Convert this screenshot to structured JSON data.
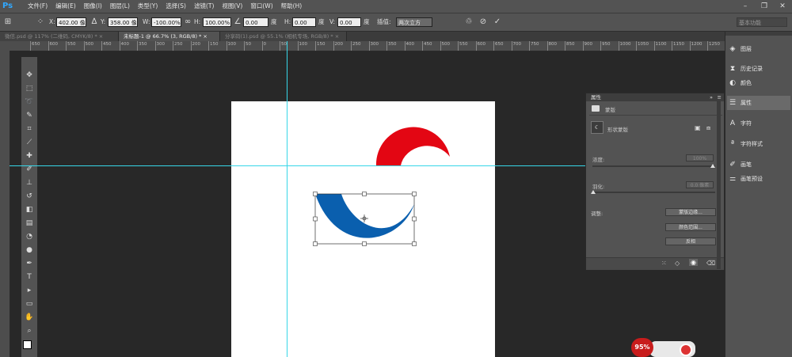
{
  "app": {
    "logo": "Ps"
  },
  "menu": [
    "文件(F)",
    "编辑(E)",
    "图像(I)",
    "图层(L)",
    "类型(Y)",
    "选择(S)",
    "滤镜(T)",
    "视图(V)",
    "窗口(W)",
    "帮助(H)"
  ],
  "window_controls": [
    "–",
    "❐",
    "✕"
  ],
  "options": {
    "x_label": "X:",
    "x_value": "402.00 像",
    "y_label": "Y:",
    "y_value": "358.00 像",
    "w_label": "W:",
    "w_value": "-100.00%",
    "h_label": "H:",
    "h_value": "100.00%",
    "angle_value": "0.00",
    "angle_unit": "度",
    "hskew_label": "H:",
    "hskew_value": "0.00",
    "hskew_unit": "度",
    "vskew_label": "V:",
    "vskew_value": "0.00",
    "vskew_unit": "度",
    "interp_label": "插值:",
    "interp_value": "两次立方",
    "workspace": "基本功能"
  },
  "tabs": [
    {
      "label": "微信.psd @ 117% (二维码, CMYK/8) *",
      "close": "×"
    },
    {
      "label": "未标题-1 @ 66.7% (3, RGB/8) *",
      "close": "×"
    },
    {
      "label": "分享码(1).psd @ 55.1% (相机专场, RGB/8) *",
      "close": "×"
    }
  ],
  "ruler_h": [
    "650",
    "600",
    "550",
    "500",
    "450",
    "400",
    "350",
    "300",
    "250",
    "200",
    "150",
    "100",
    "50",
    "0",
    "50",
    "100",
    "150",
    "200",
    "250",
    "300",
    "350",
    "400",
    "450",
    "500",
    "550",
    "600",
    "650",
    "700",
    "750",
    "800",
    "850",
    "900",
    "950",
    "1000",
    "1050",
    "1100",
    "1150",
    "1200",
    "1250"
  ],
  "dock": [
    {
      "label": "图层",
      "icon": "layers-icon"
    },
    {
      "label": "历史记录",
      "icon": "history-icon"
    },
    {
      "label": "颜色",
      "icon": "color-icon"
    },
    {
      "label": "属性",
      "icon": "properties-icon",
      "active": true
    },
    {
      "label": "字符",
      "icon": "character-icon"
    },
    {
      "label": "字符样式",
      "icon": "character-style-icon"
    },
    {
      "label": "画笔",
      "icon": "brush-icon"
    },
    {
      "label": "画笔预设",
      "icon": "brush-preset-icon"
    }
  ],
  "properties": {
    "title": "属性",
    "header_label": "蒙版",
    "mask_label": "形状蒙版",
    "density_label": "浓度:",
    "density_value": "100%",
    "feather_label": "羽化:",
    "feather_value": "0.0 像素",
    "adjust_label": "调整:",
    "btn_edge": "蒙版边缘...",
    "btn_color": "颜色范围...",
    "btn_invert": "反相"
  },
  "badge": {
    "value": "95%"
  },
  "colors": {
    "red_shape": "#e30613",
    "blue_shape": "#0a5fae",
    "guide": "#37d6e8"
  }
}
